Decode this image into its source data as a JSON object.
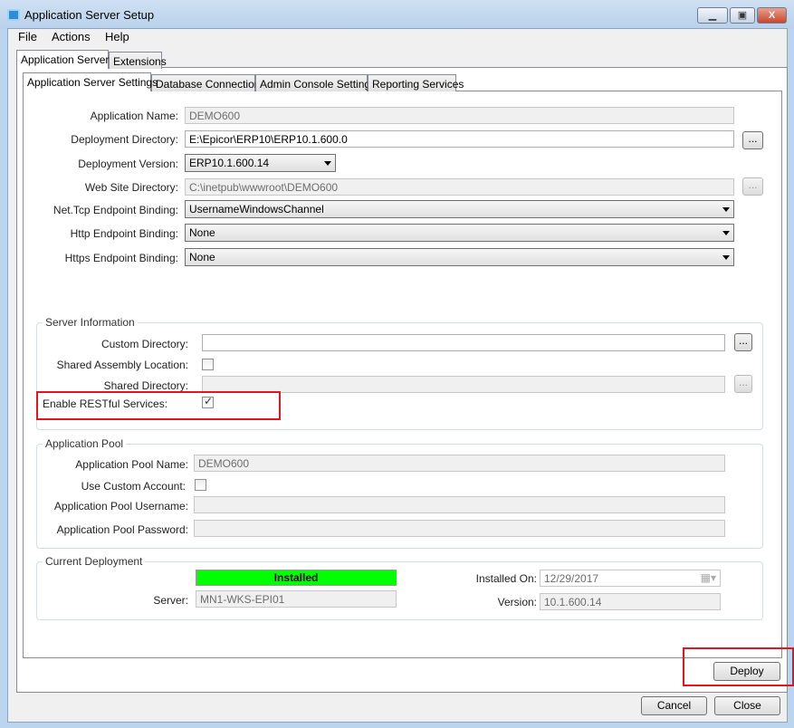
{
  "window": {
    "title": "Application Server Setup"
  },
  "menu": [
    "File",
    "Actions",
    "Help"
  ],
  "outer_tabs": [
    "Application Server",
    "Extensions"
  ],
  "inner_tabs": [
    "Application Server Settings",
    "Database Connection",
    "Admin Console Settings",
    "Reporting Services"
  ],
  "settings": {
    "app_name_label": "Application Name:",
    "app_name": "DEMO600",
    "deploy_dir_label": "Deployment Directory:",
    "deploy_dir": "E:\\Epicor\\ERP10\\ERP10.1.600.0",
    "deploy_ver_label": "Deployment Version:",
    "deploy_ver": "ERP10.1.600.14",
    "web_dir_label": "Web Site Directory:",
    "web_dir": "C:\\inetpub\\wwwroot\\DEMO600",
    "nettcp_label": "Net.Tcp Endpoint Binding:",
    "nettcp": "UsernameWindowsChannel",
    "http_label": "Http Endpoint Binding:",
    "http": "None",
    "https_label": "Https Endpoint Binding:",
    "https": "None",
    "browse": "..."
  },
  "server_info": {
    "title": "Server Information",
    "custom_dir_label": "Custom Directory:",
    "custom_dir": "",
    "shared_asm_label": "Shared Assembly Location:",
    "shared_asm": false,
    "shared_dir_label": "Shared Directory:",
    "shared_dir": "",
    "restful_label": "Enable RESTful Services:",
    "restful": true
  },
  "app_pool": {
    "title": "Application Pool",
    "name_label": "Application Pool Name:",
    "name": "DEMO600",
    "custom_label": "Use Custom Account:",
    "custom": false,
    "user_label": "Application Pool Username:",
    "user": "",
    "pass_label": "Application Pool Password:",
    "pass": ""
  },
  "current": {
    "title": "Current Deployment",
    "status": "Installed",
    "status_color": "#00ff00",
    "server_label": "Server:",
    "server": "MN1-WKS-EPI01",
    "installed_on_label": "Installed On:",
    "installed_on": "12/29/2017",
    "version_label": "Version:",
    "version": "10.1.600.14"
  },
  "buttons": {
    "deploy": "Deploy",
    "cancel": "Cancel",
    "close": "Close"
  }
}
